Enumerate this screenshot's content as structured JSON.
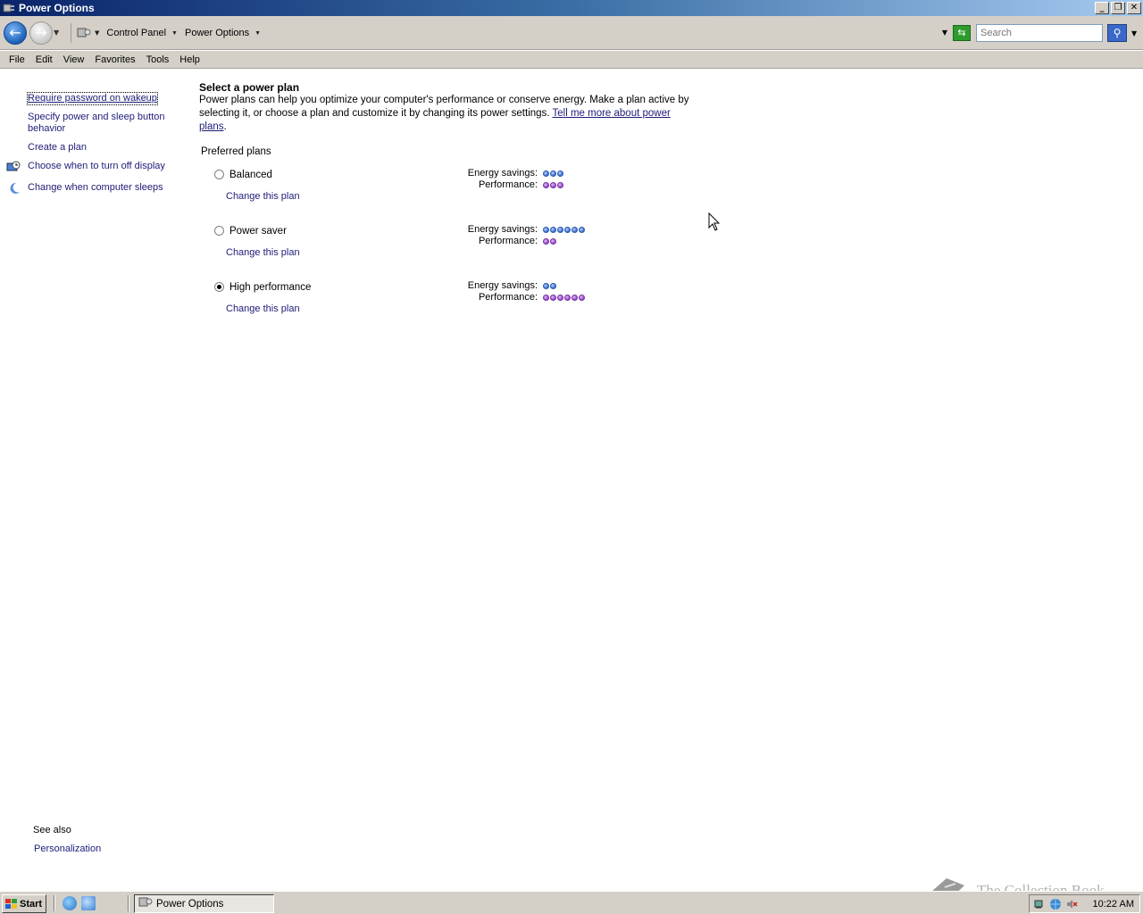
{
  "window": {
    "title": "Power Options"
  },
  "address": {
    "crumbs": [
      "Control Panel",
      "Power Options"
    ],
    "search_placeholder": "Search"
  },
  "menu": [
    "File",
    "Edit",
    "View",
    "Favorites",
    "Tools",
    "Help"
  ],
  "tasks": {
    "require_password": "Require password on wakeup",
    "specify_power_l1": "Specify power and sleep button",
    "specify_power_l2": "behavior",
    "create_plan": "Create a plan",
    "turn_off_display": "Choose when to turn off display",
    "computer_sleeps": "Change when computer sleeps"
  },
  "content": {
    "heading": "Select a power plan",
    "desc_l1": "Power plans can help you optimize your computer's performance or conserve energy. Make a plan active by",
    "desc_l2": "selecting it, or choose a plan and customize it by changing its power settings.",
    "tell_more_l1": "Tell me more about power",
    "tell_more_l2": "plans",
    "desc_end": ".",
    "group_label": "Preferred plans",
    "energy_label": "Energy savings:",
    "performance_label": "Performance:",
    "change_label": "Change this plan",
    "plans": [
      {
        "name": "Balanced",
        "selected": false,
        "energy": 3,
        "performance": 3
      },
      {
        "name": "Power saver",
        "selected": false,
        "energy": 6,
        "performance": 2
      },
      {
        "name": "High performance",
        "selected": true,
        "energy": 2,
        "performance": 6
      }
    ]
  },
  "seealso": {
    "label": "See also",
    "personalization": "Personalization"
  },
  "taskbar": {
    "start": "Start",
    "task": "Power Options",
    "clock": "10:22 AM"
  },
  "watermark": "The Collection Book"
}
